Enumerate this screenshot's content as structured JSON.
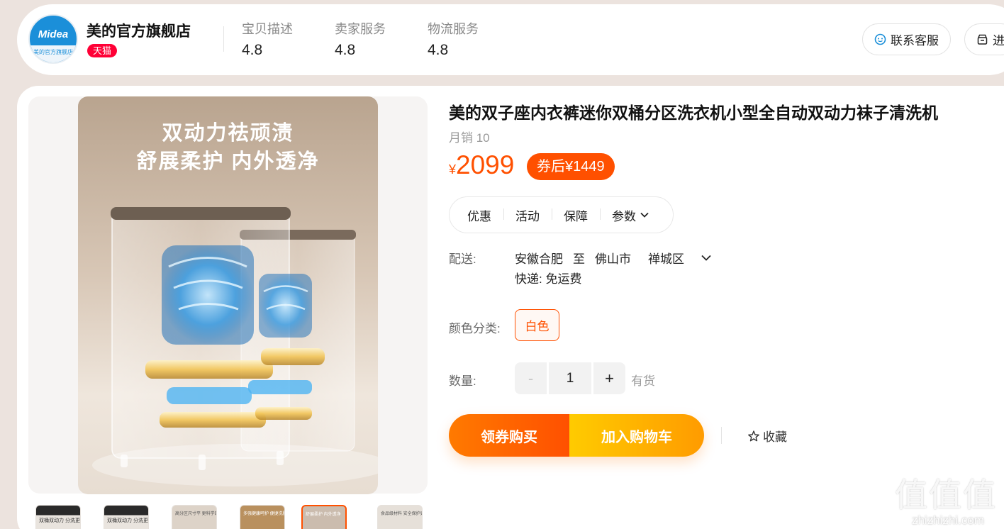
{
  "shop": {
    "logo_text": "Midea",
    "logo_sub": "美的官方旗舰店",
    "name": "美的官方旗舰店",
    "badge": "天猫",
    "scores": [
      {
        "label": "宝贝描述",
        "value": "4.8"
      },
      {
        "label": "卖家服务",
        "value": "4.8"
      },
      {
        "label": "物流服务",
        "value": "4.8"
      }
    ],
    "contact_button": "联系客服",
    "enter_button": "进"
  },
  "gallery": {
    "hero_line1": "双动力祛顽渍",
    "hero_line2": "舒展柔护 内外透净",
    "thumbs": [
      {
        "caption": "双桶双动力 分洗更健康"
      },
      {
        "caption": "双桶双动力 分洗更健康"
      },
      {
        "caption": "高分区尺寸平 更科学的洗护方式"
      },
      {
        "caption": "多强健康呵护 便捷洗脱一次到位"
      },
      {
        "caption": "舒展柔护 内外透净"
      },
      {
        "caption": "食品级材料 安全保护更健康"
      }
    ]
  },
  "product": {
    "title": "美的双子座内衣裤迷你双桶分区洗衣机小型全自动双动力袜子清洗机",
    "monthly_sales": "月销 10",
    "currency": "¥",
    "price": "2099",
    "coupon_price": "券后¥1449",
    "tabs": [
      "优惠",
      "活动",
      "保障",
      "参数"
    ],
    "shipping_label": "配送:",
    "ship_from": "安徽合肥",
    "ship_to_word": "至",
    "ship_city": "佛山市",
    "ship_district": "禅城区",
    "ship_method": "快递: 免运费",
    "color_label": "颜色分类:",
    "color_option": "白色",
    "qty_label": "数量:",
    "qty_dec": "-",
    "qty_value": "1",
    "qty_inc": "+",
    "stock": "有货",
    "buy_now": "领券购买",
    "add_cart": "加入购物车",
    "favorite": "收藏"
  },
  "watermark": {
    "glyphs": "值值值",
    "url": "zhizhizhi.com"
  },
  "colors": {
    "accent": "#ff5000",
    "tmall_red": "#ff0036",
    "brand_blue": "#1b8fd9"
  }
}
